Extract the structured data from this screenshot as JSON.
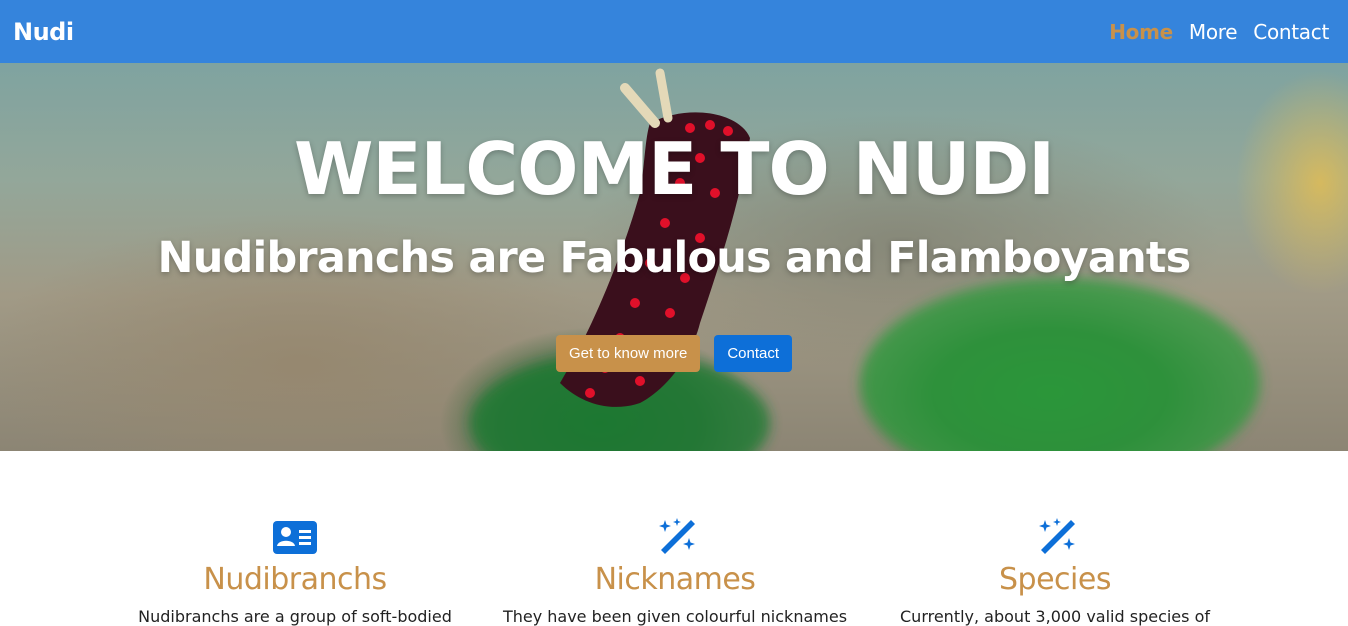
{
  "navbar": {
    "brand": "Nudi",
    "links": [
      {
        "label": "Home",
        "active": true
      },
      {
        "label": "More",
        "active": false
      },
      {
        "label": "Contact",
        "active": false
      }
    ]
  },
  "hero": {
    "title": "WELCOME TO NUDI",
    "subtitle": "Nudibranchs are Fabulous and Flamboyants",
    "buttons": {
      "primary": "Get to know more",
      "secondary": "Contact"
    }
  },
  "features": [
    {
      "icon": "person-vcard-icon",
      "title": "Nudibranchs",
      "text": "Nudibranchs are a group of soft-bodied"
    },
    {
      "icon": "magic-wand-icon",
      "title": "Nicknames",
      "text": "They have been given colourful nicknames"
    },
    {
      "icon": "magic-wand-icon",
      "title": "Species",
      "text": "Currently, about 3,000 valid species of"
    }
  ],
  "colors": {
    "navbar": "#3584dc",
    "accent": "#c8914a",
    "button_blue": "#0d6fd8",
    "icon_blue": "#0d6fd8"
  }
}
